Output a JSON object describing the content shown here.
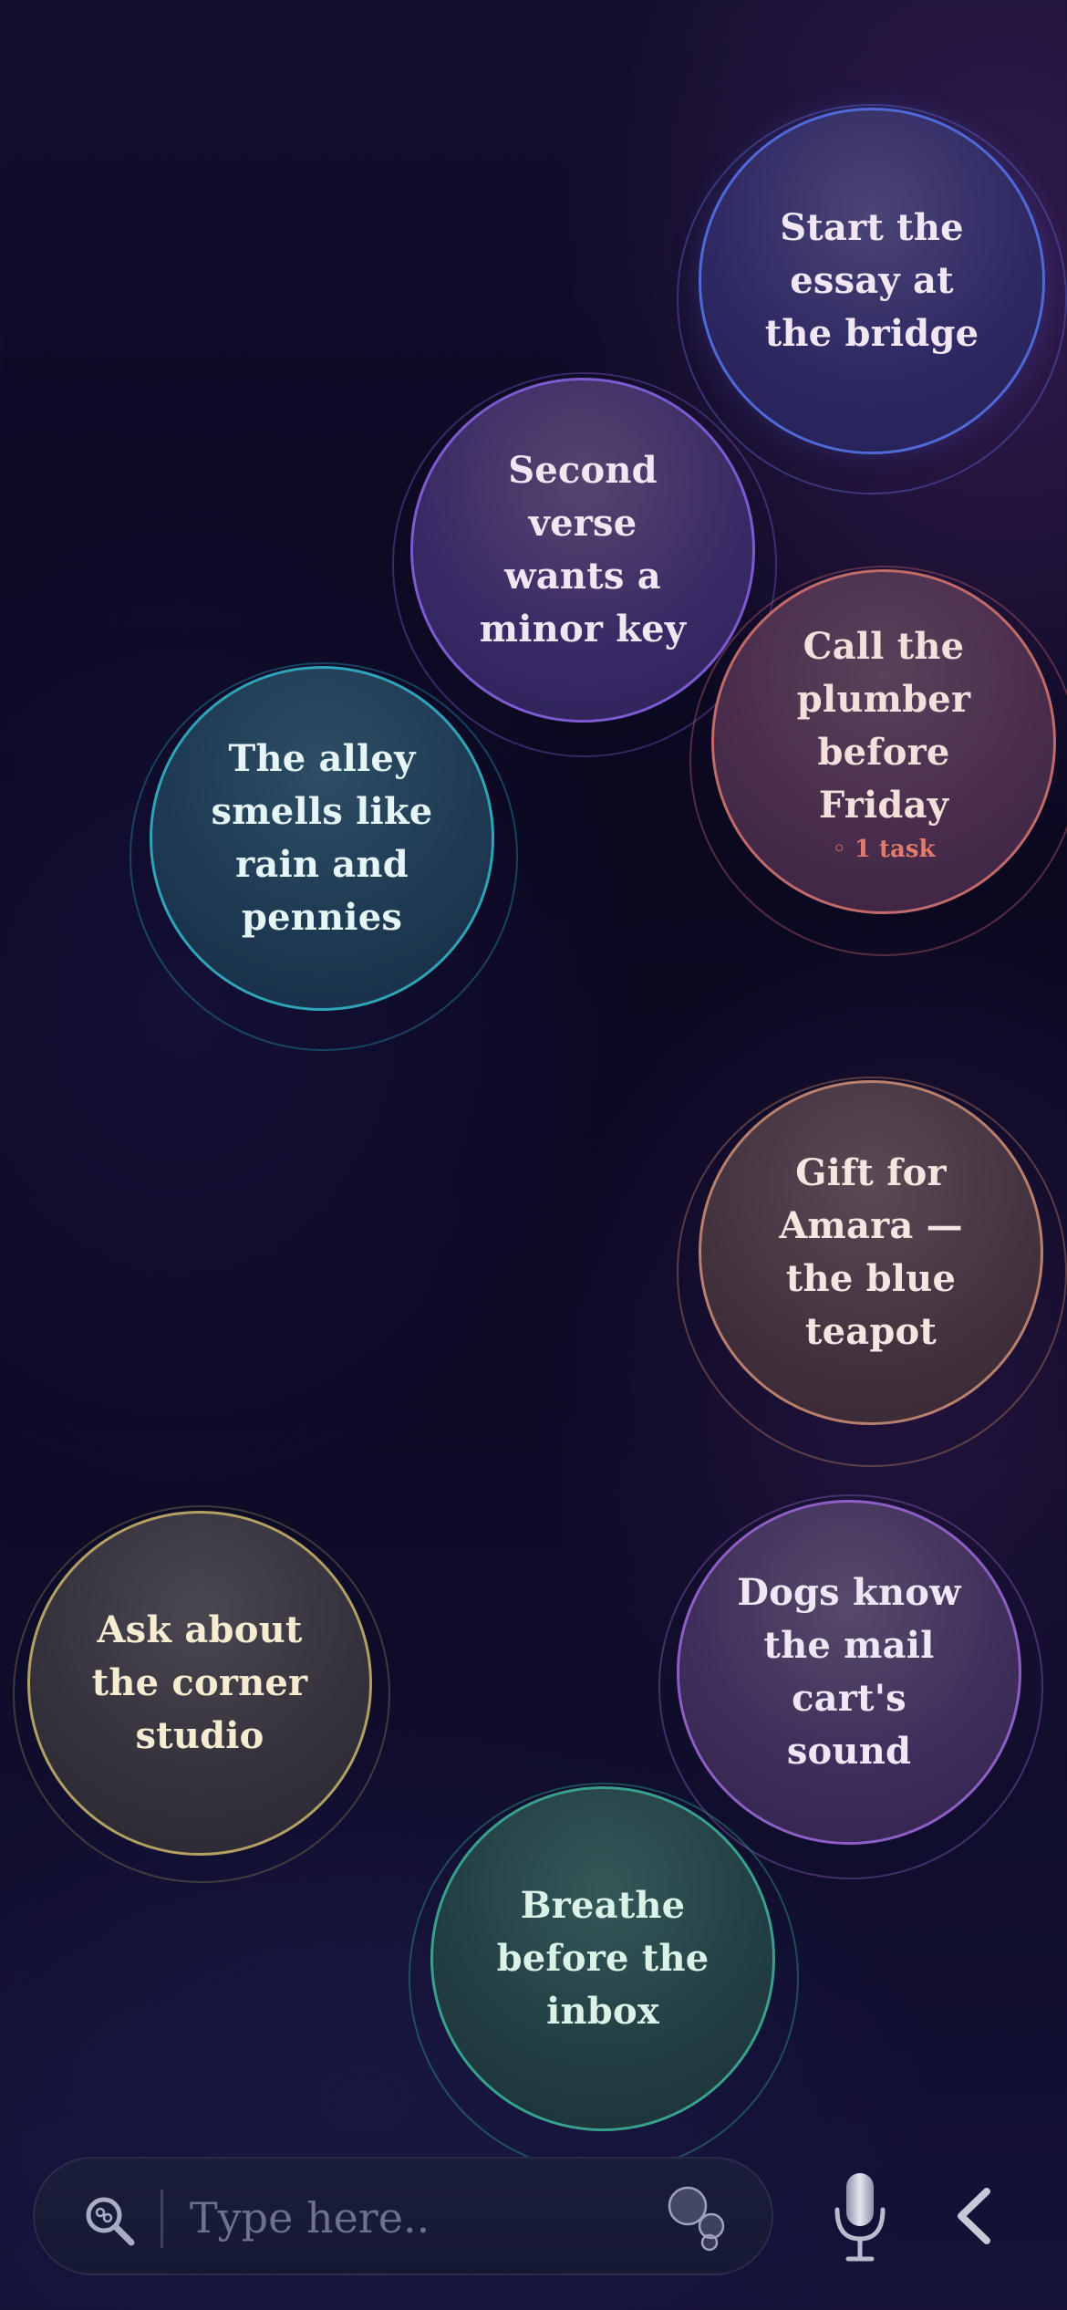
{
  "bubbles": [
    {
      "text": "Start the essay at the bridge",
      "color": "#4f6ad8"
    },
    {
      "text": "Second verse wants a minor key",
      "color": "#7d5ad0"
    },
    {
      "text": "Call the plumber before Friday",
      "meta": "◦ 1 task",
      "color": "#c06a6a"
    },
    {
      "text": "The alley smells like rain and pennies",
      "color": "#2fa3b7"
    },
    {
      "text": "Gift for Amara — the blue teapot",
      "color": "#b8806c"
    },
    {
      "text": "Ask about the corner studio",
      "color": "#b2a064"
    },
    {
      "text": "Dogs know the mail cart's sound",
      "color": "#8d5fc5"
    },
    {
      "text": "Breathe before the inbox",
      "color": "#38a08c"
    }
  ],
  "input": {
    "placeholder": "Type here.."
  },
  "icons": {
    "search": "search-icon",
    "bubbles": "bubbles-icon",
    "mic": "microphone-icon",
    "back": "chevron-left-icon"
  }
}
